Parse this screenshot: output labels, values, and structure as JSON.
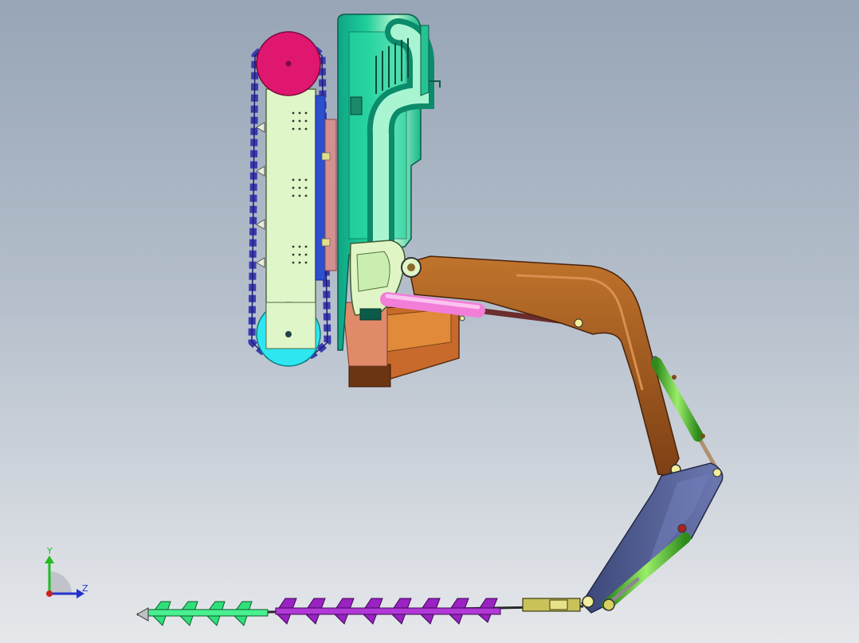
{
  "view": {
    "background_top": "#97a5b6",
    "background_bottom": "#e6e8eb"
  },
  "triad": {
    "y_label": "Y",
    "z_label": "Z",
    "y_color": "#22bb22",
    "z_color": "#2233cc",
    "x_color": "#cc2222"
  },
  "model": {
    "parts": [
      {
        "name": "crawler-track",
        "color": "#3b3bb0"
      },
      {
        "name": "drive-sprocket",
        "color": "#e0176f"
      },
      {
        "name": "idler-wheel",
        "color": "#2ee6f0"
      },
      {
        "name": "track-frame",
        "color": "#dff6c8"
      },
      {
        "name": "cab-body",
        "color": "#1fcf9a"
      },
      {
        "name": "counterweight",
        "color": "#c96a2d"
      },
      {
        "name": "boom",
        "color": "#a0561f"
      },
      {
        "name": "boom-cylinder",
        "color": "#f27ed8"
      },
      {
        "name": "stick-cylinder",
        "color": "#62c23c"
      },
      {
        "name": "stick-arm",
        "color": "#4d5a93"
      },
      {
        "name": "auger-flight-front",
        "color": "#2fe07a"
      },
      {
        "name": "auger-flight-rear",
        "color": "#9a22c2"
      },
      {
        "name": "auger-coupler",
        "color": "#c9c25a"
      }
    ]
  }
}
